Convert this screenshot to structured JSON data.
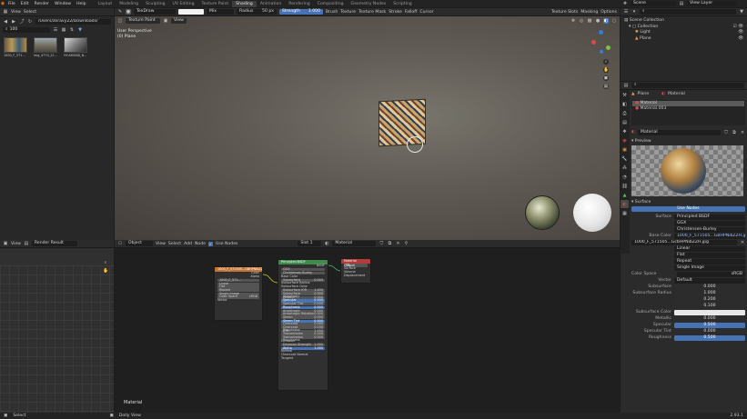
{
  "menu": [
    "File",
    "Edit",
    "Render",
    "Window",
    "Help"
  ],
  "workspaces": [
    "Layout",
    "Modeling",
    "Sculpting",
    "UV Editing",
    "Texture Paint",
    "Shading",
    "Animation",
    "Rendering",
    "Compositing",
    "Geometry Nodes",
    "Scripting"
  ],
  "active_workspace": "Shading",
  "scene_label": "Scene",
  "view_layer_label": "View Layer",
  "tool": {
    "brush": "TexDraw",
    "blend": "Mix",
    "radius_label": "Radius",
    "radius_value": "50 px",
    "strength_label": "Strength",
    "strength_value": "1.000",
    "menus": [
      "Brush",
      "Texture",
      "Texture Mask",
      "Stroke",
      "Falloff",
      "Cursor"
    ],
    "right": [
      "Texture Slots",
      "Masking",
      "Options"
    ]
  },
  "viewport": {
    "mode": "Texture Paint",
    "view_menu": "View",
    "perspective": "User Perspective",
    "object_label": "(0) Plane"
  },
  "filebrowser": {
    "view": "View",
    "select": "Select",
    "path": "/Users/zeravy22/Downloads/",
    "search": "100",
    "files": [
      "1000_F_571...",
      "img_4770_21...",
      "HY-AMGAB_N..."
    ]
  },
  "image_editor": {
    "view": "View",
    "image": "Render Result"
  },
  "node_editor": {
    "object": "Object",
    "menus": [
      "View",
      "Select",
      "Add",
      "Node"
    ],
    "use_nodes": "Use Nodes",
    "slot": "Slot 1",
    "material": "Material",
    "footer_label": "Material"
  },
  "nodes": {
    "image": {
      "title": "1000_F_571505...GBHPNibZZH.jpg",
      "outputs": [
        "Color",
        "Alpha"
      ],
      "file": "1000_F_571...",
      "opts": [
        "Linear",
        "Flat",
        "Repeat",
        "Single Image"
      ],
      "color_space_label": "Color Space",
      "color_space": "sRGB",
      "vector": "Vector"
    },
    "bsdf": {
      "title": "Principled BSDF",
      "output": "BSDF",
      "dist": [
        "GGX",
        "Christensen-Burley"
      ],
      "rows": [
        [
          "Base Color",
          ""
        ],
        [
          "Subsurface",
          "0.000"
        ],
        [
          "Subsurface Radius",
          ""
        ],
        [
          "Subsurface Color",
          ""
        ],
        [
          "Subsurface IOR",
          "1.400"
        ],
        [
          "Subsurface Anisotropy",
          "0.000"
        ],
        [
          "Metallic",
          "0.000"
        ],
        [
          "Specular",
          "0.500"
        ],
        [
          "Specular Tint",
          "0.000"
        ],
        [
          "Roughness",
          "0.500"
        ],
        [
          "Anisotropic",
          "0.000"
        ],
        [
          "Anisotropic Rotation",
          "0.000"
        ],
        [
          "Sheen",
          "0.000"
        ],
        [
          "Sheen Tint",
          "0.500"
        ],
        [
          "Clearcoat",
          "0.000"
        ],
        [
          "Clearcoat Roughness",
          "0.030"
        ],
        [
          "IOR",
          "1.450"
        ],
        [
          "Transmission",
          "0.000"
        ],
        [
          "Transmission Roughness",
          "0.000"
        ],
        [
          "Emission",
          ""
        ],
        [
          "Emission Strength",
          "1.000"
        ],
        [
          "Alpha",
          "1.000"
        ],
        [
          "Normal",
          ""
        ],
        [
          "Clearcoat Normal",
          ""
        ],
        [
          "Tangent",
          ""
        ]
      ]
    },
    "output": {
      "title": "Material Output",
      "target": "All",
      "inputs": [
        "Surface",
        "Volume",
        "Displacement"
      ]
    }
  },
  "outliner": {
    "search": "",
    "items": [
      "Scene Collection",
      "Collection",
      "Light",
      "Plane"
    ]
  },
  "properties": {
    "object_name": "Plane",
    "material_name": "Material",
    "slots": [
      "Material",
      "Material.003"
    ],
    "material_field": "Material",
    "preview_label": "Preview",
    "surface_section": "Surface",
    "use_nodes_btn": "Use Nodes",
    "surface_label": "Surface",
    "surface_value": "Principled BSDF",
    "distribution": "GGX",
    "subsurface_method": "Christensen-Burley",
    "base_color_label": "Base Color",
    "base_color_value": "1000_F_571505...GBHPNibZZH.jpg",
    "image_file": "1000_F_571505...GcbHPNibZZH.jpg",
    "interp": "Linear",
    "projection": "Flat",
    "extension": "Repeat",
    "source": "Single Image",
    "color_space_label": "Color Space",
    "color_space": "sRGB",
    "vector_label": "Vector",
    "vector_value": "Default",
    "subsurface_label": "Subsurface",
    "subsurface_value": "0.000",
    "subsurface_radius_label": "Subsurface Radius",
    "subsurface_radius": [
      "1.000",
      "0.200",
      "0.100"
    ],
    "subsurface_color_label": "Subsurface Color",
    "metallic_label": "Metallic",
    "metallic_value": "0.000",
    "specular_label": "Specular",
    "specular_value": "0.500",
    "specular_tint_label": "Specular Tint",
    "specular_tint_value": "0.000",
    "roughness_label": "Roughness",
    "roughness_value": "0.500"
  },
  "status": {
    "left": "Select",
    "mid": "Dolly View",
    "version": "2.93.1"
  },
  "colors": {
    "accent": "#4772b3",
    "node_image_header": "#c37534",
    "node_bsdf_header": "#3f8a4c",
    "node_output_header": "#b33b3b"
  }
}
